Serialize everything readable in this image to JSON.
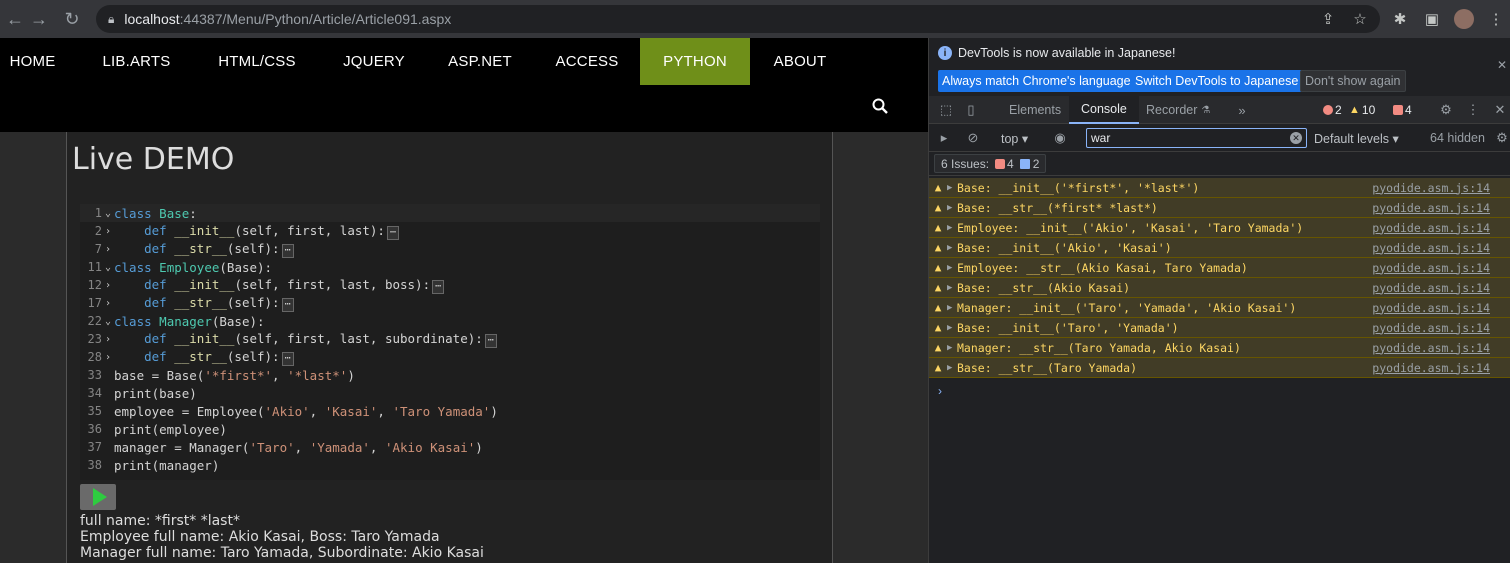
{
  "browser": {
    "url_host": "localhost",
    "url_path": ":44387/Menu/Python/Article/Article091.aspx"
  },
  "nav": {
    "items": [
      "HOME",
      "LIB.ARTS",
      "HTML/CSS",
      "JQUERY",
      "ASP.NET",
      "ACCESS",
      "PYTHON",
      "ABOUT"
    ],
    "active": "PYTHON",
    "active_color": "#6f8f19"
  },
  "page": {
    "title": "Live DEMO"
  },
  "editor": {
    "lines": [
      {
        "num": "1",
        "fold": "⌄"
      },
      {
        "num": "2",
        "fold": "›"
      },
      {
        "num": "7",
        "fold": "›"
      },
      {
        "num": "11",
        "fold": "⌄"
      },
      {
        "num": "12",
        "fold": "›"
      },
      {
        "num": "17",
        "fold": "›"
      },
      {
        "num": "22",
        "fold": "⌄"
      },
      {
        "num": "23",
        "fold": "›"
      },
      {
        "num": "28",
        "fold": "›"
      },
      {
        "num": "33",
        "fold": ""
      },
      {
        "num": "34",
        "fold": ""
      },
      {
        "num": "35",
        "fold": ""
      },
      {
        "num": "36",
        "fold": ""
      },
      {
        "num": "37",
        "fold": ""
      },
      {
        "num": "38",
        "fold": ""
      }
    ],
    "tokens": {
      "kw_class": "class",
      "kw_def": "def",
      "base": "Base",
      "employee": "Employee",
      "manager": "Manager",
      "init": "__init__",
      "str": "__str__",
      "colon": ":",
      "params_init_base": "(self, first, last):",
      "params_self": "(self):",
      "params_init_emp": "(self, first, last, boss):",
      "params_init_mgr": "(self, first, last, subordinate):",
      "paren_base": "(Base):",
      "ellipsis": "⋯",
      "l33_a": "base = Base(",
      "l33_s1": "'*first*'",
      "comma": ", ",
      "l33_s2": "'*last*'",
      "close": ")",
      "l34": "print(base)",
      "l35_a": "employee = Employee(",
      "l35_s1": "'Akio'",
      "l35_s2": "'Kasai'",
      "l35_s3": "'Taro Yamada'",
      "l36": "print(employee)",
      "l37_a": "manager = Manager(",
      "l37_s1": "'Taro'",
      "l37_s2": "'Yamada'",
      "l37_s3": "'Akio Kasai'",
      "l38": "print(manager)"
    }
  },
  "output": [
    "full name: *first* *last*",
    "Employee full name: Akio Kasai, Boss: Taro Yamada",
    "Manager full name: Taro Yamada, Subordinate: Akio Kasai"
  ],
  "devtools": {
    "banner_message": "DevTools is now available in Japanese!",
    "btn_match": "Always match Chrome's language",
    "btn_switch": "Switch DevTools to Japanese",
    "btn_dont_show": "Don't show again",
    "tabs": {
      "elements": "Elements",
      "console": "Console",
      "recorder": "Recorder"
    },
    "counts": {
      "errors": "2",
      "warnings": "10",
      "issues": "4"
    },
    "filter": {
      "context": "top",
      "value": "war",
      "levels": "Default levels",
      "hidden": "64 hidden"
    },
    "issues_bar": {
      "label": "6 Issues:",
      "errors": "4",
      "info": "2"
    },
    "logs": [
      {
        "msg": "Base: __init__('*first*', '*last*')",
        "src": "pyodide.asm.js:14"
      },
      {
        "msg": "Base: __str__(*first* *last*)",
        "src": "pyodide.asm.js:14"
      },
      {
        "msg": "Employee: __init__('Akio', 'Kasai', 'Taro Yamada')",
        "src": "pyodide.asm.js:14"
      },
      {
        "msg": "Base: __init__('Akio', 'Kasai')",
        "src": "pyodide.asm.js:14"
      },
      {
        "msg": "Employee: __str__(Akio Kasai, Taro Yamada)",
        "src": "pyodide.asm.js:14"
      },
      {
        "msg": "Base: __str__(Akio Kasai)",
        "src": "pyodide.asm.js:14"
      },
      {
        "msg": "Manager: __init__('Taro', 'Yamada', 'Akio Kasai')",
        "src": "pyodide.asm.js:14"
      },
      {
        "msg": "Base: __init__('Taro', 'Yamada')",
        "src": "pyodide.asm.js:14"
      },
      {
        "msg": "Manager: __str__(Taro Yamada, Akio Kasai)",
        "src": "pyodide.asm.js:14"
      },
      {
        "msg": "Base: __str__(Taro Yamada)",
        "src": "pyodide.asm.js:14"
      }
    ]
  }
}
